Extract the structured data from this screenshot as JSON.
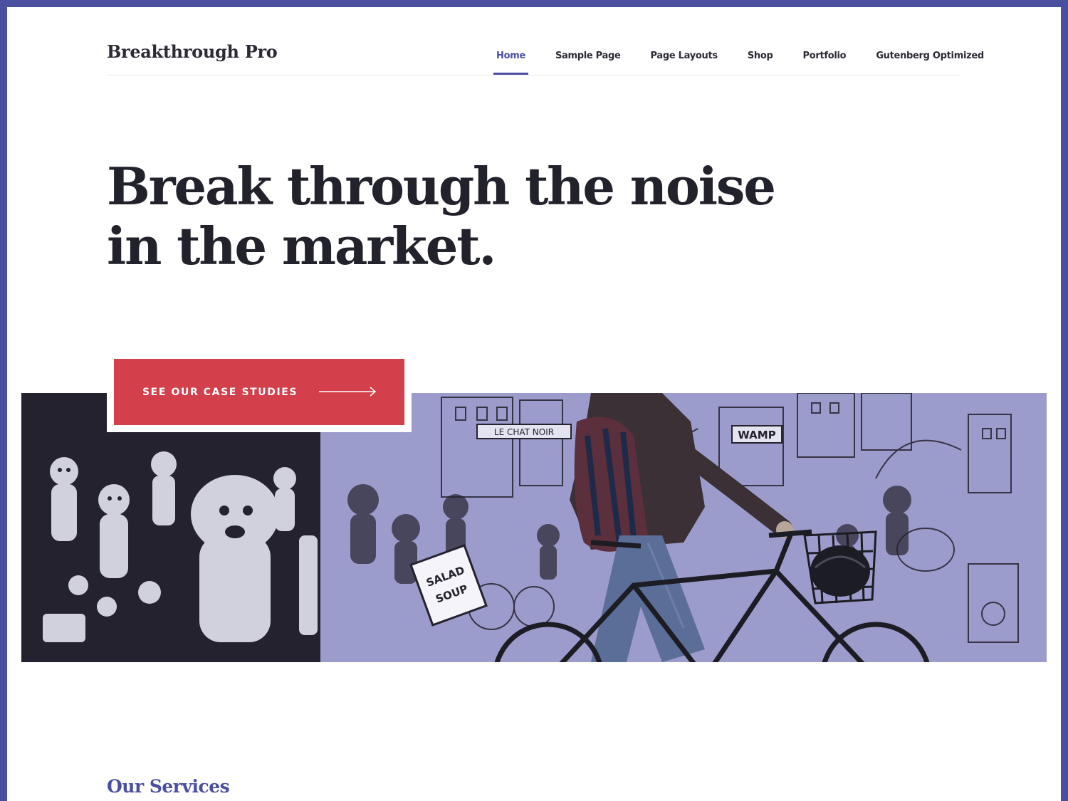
{
  "brand": {
    "site_title": "Breakthrough Pro"
  },
  "nav": {
    "items": [
      {
        "label": "Home",
        "active": true
      },
      {
        "label": "Sample Page",
        "active": false
      },
      {
        "label": "Page Layouts",
        "active": false
      },
      {
        "label": "Shop",
        "active": false
      },
      {
        "label": "Portfolio",
        "active": false
      },
      {
        "label": "Gutenberg Optimized",
        "active": false
      }
    ]
  },
  "hero": {
    "title_line1": "Break through the noise",
    "title_line2": "in the market.",
    "cta_label": "SEE OUR CASE STUDIES",
    "cta_icon": "arrow-right-icon",
    "image_alt": "Person walking a bicycle past a black and white street-art mural"
  },
  "mural_text": {
    "sign_1": "LE CHAT NOIR",
    "sign_2": "WAMP",
    "sign_3": "SALAD",
    "sign_4": "SOUP"
  },
  "sections": {
    "services_title": "Our Services"
  },
  "colors": {
    "frame": "#4b4fa0",
    "accent": "#4b4fa0",
    "cta_background": "#d33f4a",
    "heading_text": "#22222c",
    "background": "#ffffff"
  }
}
